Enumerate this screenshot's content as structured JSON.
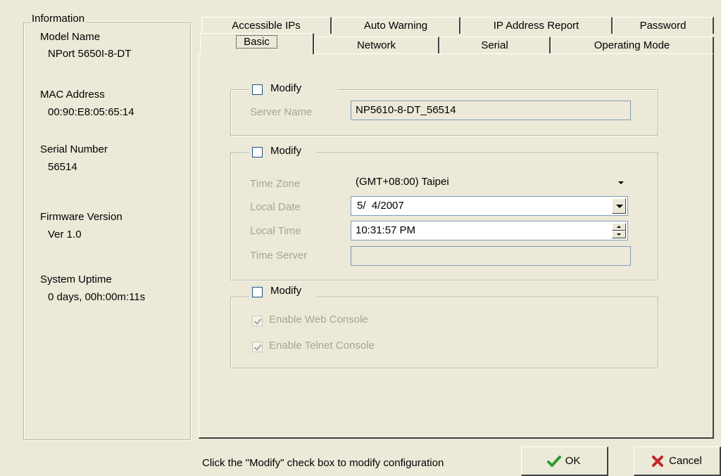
{
  "info": {
    "title": "Information",
    "model_name_label": "Model Name",
    "model_name": "NPort 5650I-8-DT",
    "mac_label": "MAC Address",
    "mac": "00:90:E8:05:65:14",
    "serial_label": "Serial Number",
    "serial": "56514",
    "firmware_label": "Firmware Version",
    "firmware": "Ver 1.0",
    "uptime_label": "System Uptime",
    "uptime": "0 days, 00h:00m:11s"
  },
  "tabs_row1": [
    "Accessible IPs",
    "Auto Warning",
    "IP Address Report",
    "Password"
  ],
  "tabs_row2": [
    "Basic",
    "Network",
    "Serial",
    "Operating Mode"
  ],
  "basic": {
    "group1": {
      "modify_label": "Modify",
      "server_name_label": "Server Name",
      "server_name": "NP5610-8-DT_56514"
    },
    "group2": {
      "modify_label": "Modify",
      "time_zone_label": "Time Zone",
      "time_zone": "(GMT+08:00) Taipei",
      "local_date_label": "Local Date",
      "local_date": "5/  4/2007",
      "local_time_label": "Local Time",
      "local_time": "10:31:57 PM",
      "time_server_label": "Time Server",
      "time_server": ""
    },
    "group3": {
      "modify_label": "Modify",
      "web_console_label": "Enable Web Console",
      "telnet_console_label": "Enable Telnet Console"
    }
  },
  "footer": {
    "hint": "Click the \"Modify\" check box to modify configuration",
    "ok_label": "OK",
    "cancel_label": "Cancel"
  },
  "colors": {
    "background": "#ece9d8",
    "disabled_text": "#a7a491",
    "ok_check": "#2e9b2e",
    "cancel_x": "#c0282a"
  }
}
